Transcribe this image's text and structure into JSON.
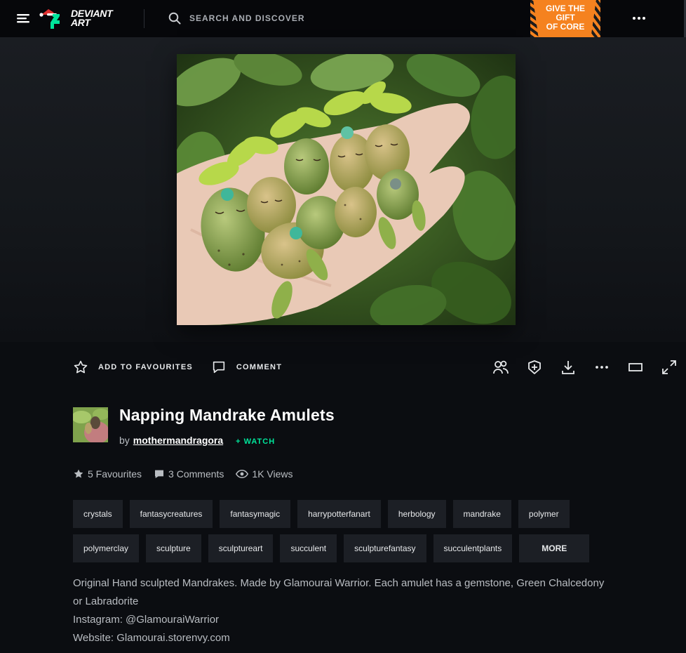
{
  "header": {
    "logo_text": "DEVIANT\nART",
    "search_placeholder": "SEARCH AND DISCOVER",
    "promo_text": "GIVE THE\nGIFT\nOF CORE",
    "brand_green": "#00e59b",
    "promo_color": "#f5821f"
  },
  "actions": {
    "favourite_label": "ADD TO FAVOURITES",
    "comment_label": "COMMENT"
  },
  "deviation": {
    "title": "Napping Mandrake Amulets",
    "by_label": "by",
    "author": "mothermandragora",
    "watch_label": "+ WATCH"
  },
  "stats": {
    "favourites": "5 Favourites",
    "comments": "3 Comments",
    "views": "1K Views"
  },
  "tags": [
    "crystals",
    "fantasycreatures",
    "fantasymagic",
    "harrypotterfanart",
    "herbology",
    "mandrake",
    "polymer",
    "polymerclay",
    "sculpture",
    "sculptureart",
    "succulent",
    "sculpturefantasy",
    "succulentplants"
  ],
  "more_label": "MORE",
  "description": {
    "line1": "Original Hand sculpted Mandrakes. Made by Glamourai Warrior. Each amulet has a gemstone, Green Chalcedony or Labradorite",
    "line2": "Instagram: @GlamouraiWarrior",
    "line3": "Website: Glamourai.storenvy.com"
  }
}
